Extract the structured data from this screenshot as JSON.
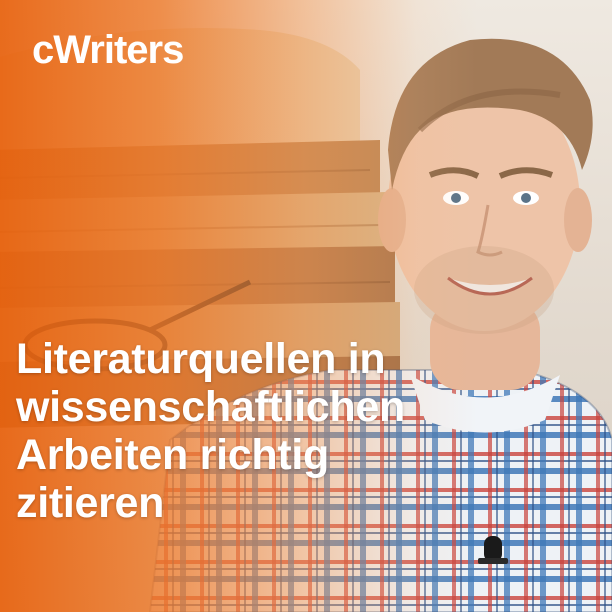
{
  "brand": {
    "logo_text": "cWriters"
  },
  "headline": {
    "lines": [
      "Literaturquellen in",
      "wissenschaftlichen",
      "Arbeiten richtig",
      "zitieren"
    ]
  },
  "colors": {
    "brand_orange": "#e8620e",
    "text": "#ffffff"
  },
  "icons": {
    "microphone": "lavalier-microphone-icon"
  }
}
